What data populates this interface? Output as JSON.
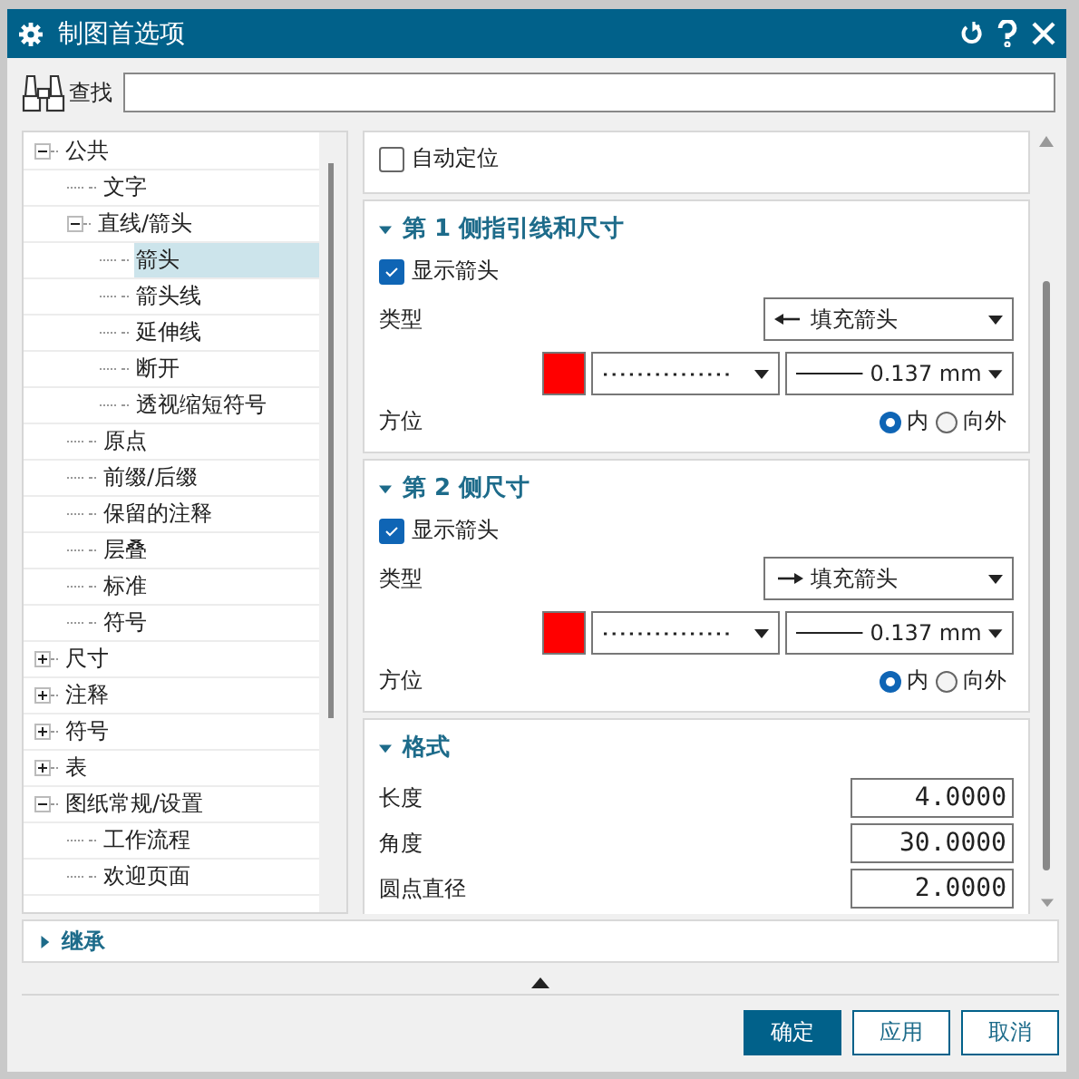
{
  "window": {
    "title": "制图首选项"
  },
  "search": {
    "label": "查找"
  },
  "tree": [
    {
      "label": "公共",
      "expanded": true,
      "selected": false,
      "children": [
        {
          "label": "文字",
          "selected": false
        },
        {
          "label": "直线/箭头",
          "expanded": true,
          "selected": false,
          "children": [
            {
              "label": "箭头",
              "selected": true
            },
            {
              "label": "箭头线",
              "selected": false
            },
            {
              "label": "延伸线",
              "selected": false
            },
            {
              "label": "断开",
              "selected": false
            },
            {
              "label": "透视缩短符号",
              "selected": false
            }
          ]
        },
        {
          "label": "原点",
          "selected": false
        },
        {
          "label": "前缀/后缀",
          "selected": false
        },
        {
          "label": "保留的注释",
          "selected": false
        },
        {
          "label": "层叠",
          "selected": false
        },
        {
          "label": "标准",
          "selected": false
        },
        {
          "label": "符号",
          "selected": false
        }
      ]
    },
    {
      "label": "尺寸",
      "expanded": false,
      "selected": false
    },
    {
      "label": "注释",
      "expanded": false,
      "selected": false
    },
    {
      "label": "符号",
      "expanded": false,
      "selected": false
    },
    {
      "label": "表",
      "expanded": false,
      "selected": false
    },
    {
      "label": "图纸常规/设置",
      "expanded": true,
      "selected": false,
      "children": [
        {
          "label": "工作流程",
          "selected": false
        },
        {
          "label": "欢迎页面",
          "selected": false
        }
      ]
    }
  ],
  "sections": [
    {
      "kind": "checkbox",
      "label": "自动定位",
      "checked": false
    },
    {
      "kind": "arrow",
      "title": "第 1 侧指引线和尺寸",
      "expanded": true,
      "show_arrow": {
        "label": "显示箭头",
        "checked": true
      },
      "type_label": "类型",
      "type_value": "填充箭头",
      "arrow_points_left": true,
      "color": "#ff0000",
      "width_value": "0.137 mm",
      "orientation_label": "方位",
      "orientation_options": [
        {
          "label": "内",
          "selected": true
        },
        {
          "label": "向外",
          "selected": false
        }
      ]
    },
    {
      "kind": "arrow",
      "title": "第 2 侧尺寸",
      "expanded": true,
      "show_arrow": {
        "label": "显示箭头",
        "checked": true
      },
      "type_label": "类型",
      "type_value": "填充箭头",
      "arrow_points_left": false,
      "color": "#ff0000",
      "width_value": "0.137 mm",
      "orientation_label": "方位",
      "orientation_options": [
        {
          "label": "内",
          "selected": true
        },
        {
          "label": "向外",
          "selected": false
        }
      ]
    },
    {
      "kind": "fields",
      "title": "格式",
      "expanded": true,
      "fields": [
        {
          "label": "长度",
          "value": "4.0000"
        },
        {
          "label": "角度",
          "value": "30.0000"
        },
        {
          "label": "圆点直径",
          "value": "2.0000"
        }
      ]
    }
  ],
  "inherit": {
    "title": "继承",
    "expanded": false
  },
  "buttons": [
    {
      "label": "确定",
      "primary": true
    },
    {
      "label": "应用",
      "primary": false
    },
    {
      "label": "取消",
      "primary": false
    }
  ]
}
